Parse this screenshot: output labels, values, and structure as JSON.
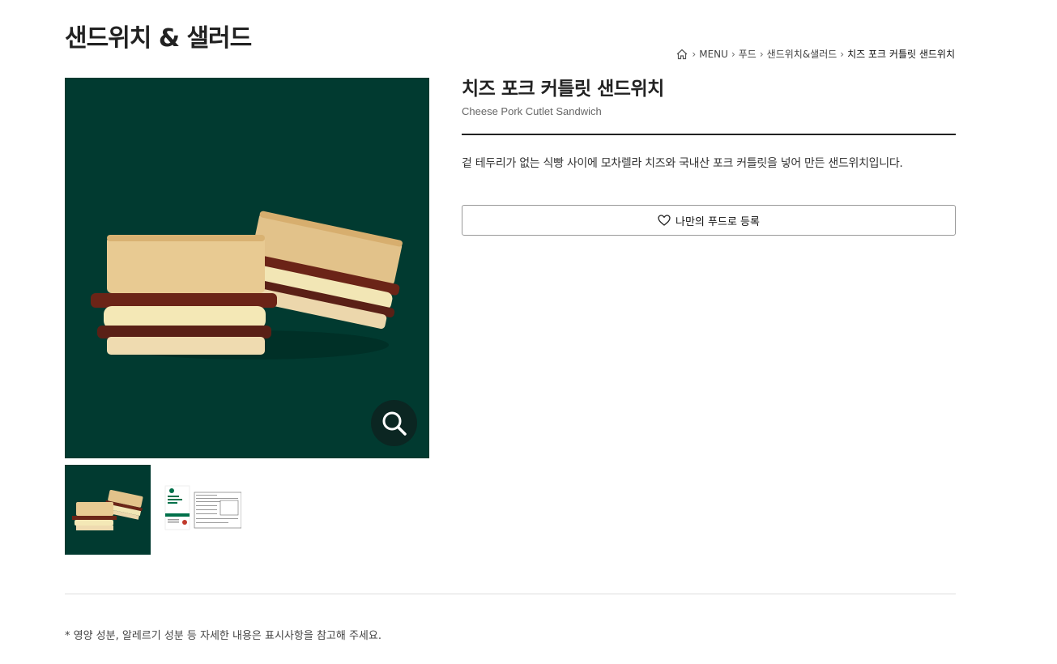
{
  "page": {
    "title": "샌드위치 & 샐러드"
  },
  "breadcrumb": {
    "home_icon": "home-icon",
    "items": [
      "MENU",
      "푸드",
      "샌드위치&샐러드",
      "치즈 포크 커틀릿 샌드위치"
    ]
  },
  "product": {
    "name_ko": "치즈 포크 커틀릿 샌드위치",
    "name_en": "Cheese Pork Cutlet Sandwich",
    "description": "겉 테두리가 없는 식빵 사이에 모차렐라 치즈와 국내산 포크 커틀릿을 넣어 만든 샌드위치입니다.",
    "favorite_label": "나만의 푸드로 등록",
    "image_bg": "#013a30"
  },
  "gallery": {
    "zoom_icon": "search-icon",
    "thumbnails": [
      "product-photo",
      "package-label"
    ]
  },
  "footnote": "* 영양 성분, 알레르기 성분 등 자세한 내용은 표시사항을 참고해 주세요."
}
